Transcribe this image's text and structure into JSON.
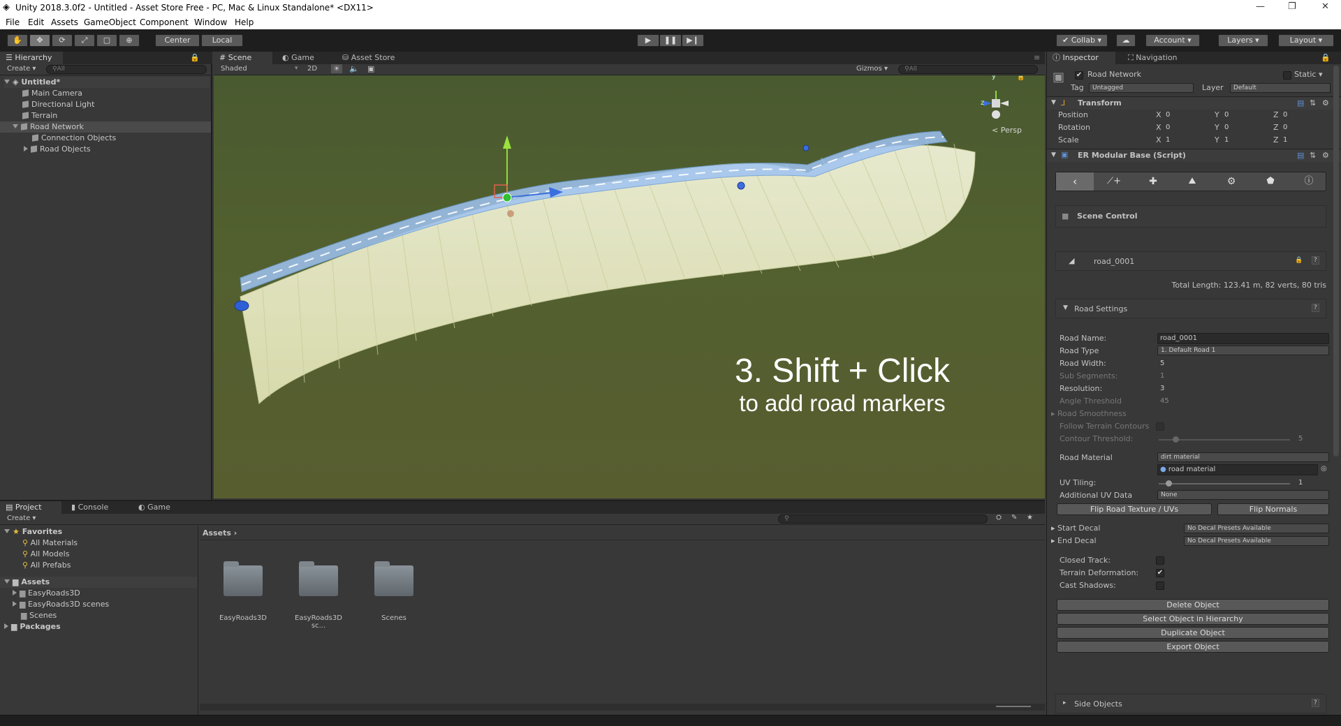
{
  "window": {
    "title": "Unity 2018.3.0f2 - Untitled - Asset Store Free - PC, Mac & Linux Standalone* <DX11>"
  },
  "menu": [
    "File",
    "Edit",
    "Assets",
    "GameObject",
    "Component",
    "Window",
    "Help"
  ],
  "toolbar": {
    "pivot_center": "Center",
    "pivot_local": "Local",
    "collab": "Collab",
    "account": "Account",
    "layers": "Layers",
    "layout": "Layout"
  },
  "hierarchy": {
    "tab": "Hierarchy",
    "create": "Create",
    "search_placeholder": "All",
    "scene_name": "Untitled*",
    "items": [
      "Main Camera",
      "Directional Light",
      "Terrain",
      "Road Network",
      "Connection Objects",
      "Road Objects"
    ]
  },
  "scene_view": {
    "tabs": [
      "Scene",
      "Game",
      "Asset Store"
    ],
    "shading": "Shaded",
    "mode2d": "2D",
    "gizmos": "Gizmos",
    "search_placeholder": "All",
    "persp": "Persp",
    "overlay_line1": "3. Shift + Click",
    "overlay_line2": "to add road markers"
  },
  "project": {
    "tabs": [
      "Project",
      "Console",
      "Game"
    ],
    "create": "Create",
    "favorites_label": "Favorites",
    "favorites": [
      "All Materials",
      "All Models",
      "All Prefabs"
    ],
    "assets_label": "Assets",
    "assets_tree": [
      "EasyRoads3D",
      "EasyRoads3D scenes",
      "Scenes"
    ],
    "packages_label": "Packages",
    "breadcrumb": "Assets",
    "folders": [
      "EasyRoads3D",
      "EasyRoads3D sc...",
      "Scenes"
    ]
  },
  "inspector": {
    "tabs": [
      "Inspector",
      "Navigation"
    ],
    "object_name": "Road Network",
    "static_label": "Static",
    "tag_label": "Tag",
    "tag_value": "Untagged",
    "layer_label": "Layer",
    "layer_value": "Default",
    "transform": {
      "title": "Transform",
      "rows": [
        {
          "label": "Position",
          "x": "0",
          "y": "0",
          "z": "0"
        },
        {
          "label": "Rotation",
          "x": "0",
          "y": "0",
          "z": "0"
        },
        {
          "label": "Scale",
          "x": "1",
          "y": "1",
          "z": "1"
        }
      ]
    },
    "script_title": "ER Modular Base (Script)",
    "scene_control": "Scene Control",
    "road_object": "road_0001",
    "total_length": "Total Length: 123.41 m, 82 verts, 80 tris",
    "road_settings": "Road Settings",
    "settings": [
      {
        "label": "Road Name:",
        "value": "road_0001",
        "kind": "field",
        "dim": false
      },
      {
        "label": "Road Type",
        "value": "1. Default Road 1",
        "kind": "drop",
        "dim": false
      },
      {
        "label": "Road Width:",
        "value": "5",
        "kind": "field",
        "dim": false
      },
      {
        "label": "Sub Segments:",
        "value": "1",
        "kind": "field",
        "dim": true
      },
      {
        "label": "Resolution:",
        "value": "3",
        "kind": "field",
        "dim": false
      },
      {
        "label": "Angle Threshold",
        "value": "45",
        "kind": "field",
        "dim": true
      },
      {
        "label": "Road Smoothness",
        "value": "",
        "kind": "fold",
        "dim": true
      },
      {
        "label": "Follow Terrain Contours",
        "value": "",
        "kind": "check",
        "dim": true
      },
      {
        "label": "Contour Threshold:",
        "value": "5",
        "kind": "slider",
        "dim": true
      }
    ],
    "road_material_label": "Road Material",
    "road_material_drop": "dirt material",
    "road_material_obj": "road material",
    "uv_tiling_label": "UV Tiling:",
    "uv_tiling_value": "1",
    "additional_uv_label": "Additional UV Data",
    "additional_uv_value": "None",
    "flip_texture": "Flip Road Texture / UVs",
    "flip_normals": "Flip Normals",
    "start_decal": "Start Decal",
    "end_decal": "End Decal",
    "decal_value": "No Decal Presets Available",
    "closed_track": "Closed Track:",
    "terrain_deformation": "Terrain Deformation:",
    "cast_shadows": "Cast Shadows:",
    "buttons": [
      "Delete Object",
      "Select Object in Hierarchy",
      "Duplicate Object",
      "Export Object"
    ],
    "side_objects": "Side Objects"
  }
}
